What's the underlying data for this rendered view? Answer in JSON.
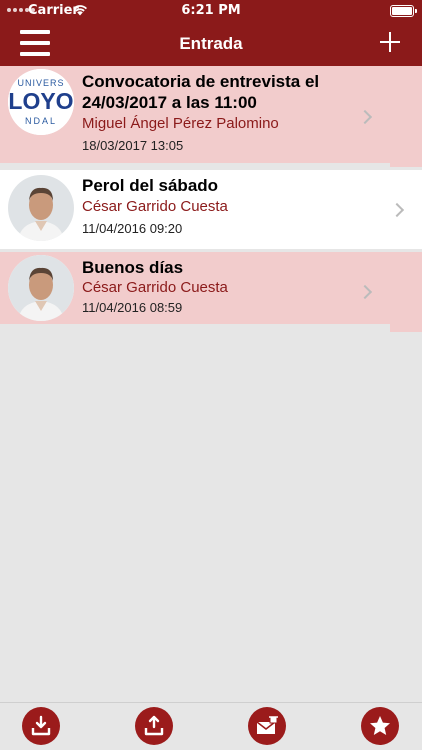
{
  "status_bar": {
    "carrier": "Carrier",
    "time": "6:21 PM"
  },
  "nav": {
    "title": "Entrada"
  },
  "messages": [
    {
      "subject": "Convocatoria de entrevista el 24/03/2017 a las 11:00",
      "sender": "Miguel Ángel Pérez  Palomino",
      "date": "18/03/2017 13:05",
      "unread": true,
      "avatar_text": {
        "top": "UNIVERS",
        "middle": "LOYO",
        "bottom": "NDAL"
      }
    },
    {
      "subject": "Perol del sábado",
      "sender": "César Garrido Cuesta",
      "date": "11/04/2016 09:20",
      "unread": false
    },
    {
      "subject": "Buenos días",
      "sender": "César Garrido Cuesta",
      "date": "11/04/2016 08:59",
      "unread": true
    }
  ],
  "toolbar": {
    "items": [
      "inbox-download-icon",
      "outbox-upload-icon",
      "mail-trash-icon",
      "star-icon"
    ]
  },
  "colors": {
    "brand": "#8b1a1a",
    "unread_bg": "#f2cccc",
    "background": "#e6e6e6"
  }
}
